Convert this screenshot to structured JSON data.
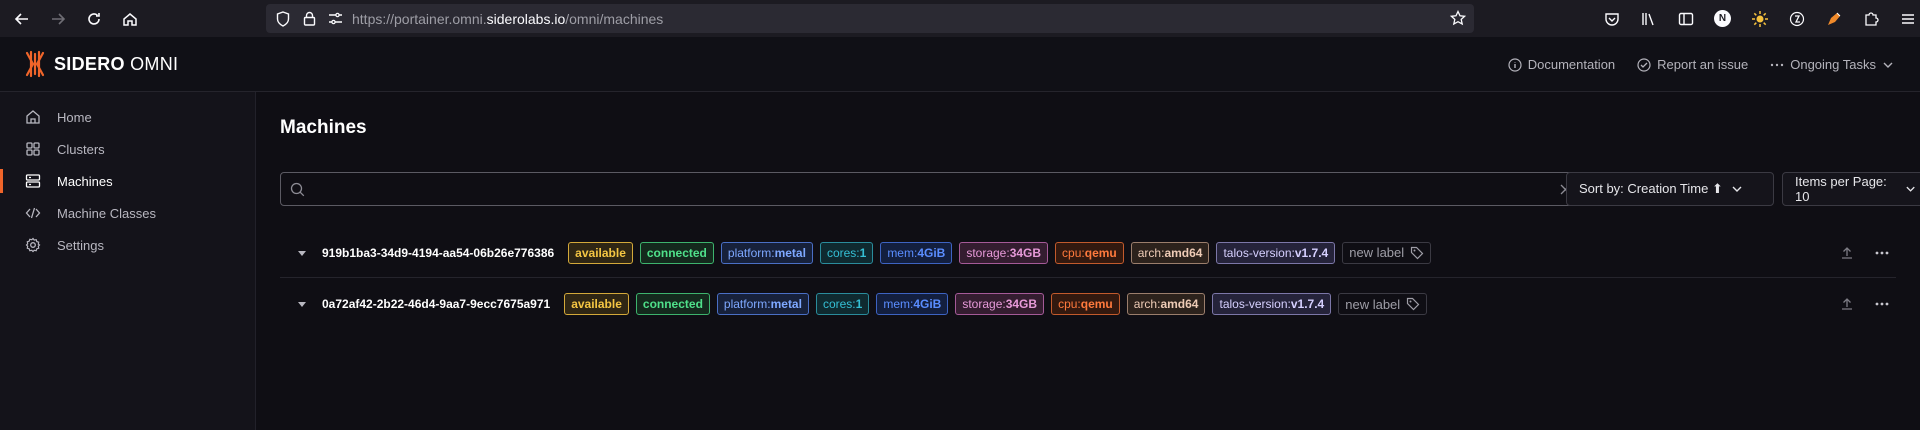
{
  "browser": {
    "url_prefix": "https://portainer.omni.",
    "url_domain": "siderolabs.io",
    "url_path": "/omni/machines",
    "profile_initial": "N"
  },
  "header": {
    "logo_bold": "SIDERO",
    "logo_light": " OMNI",
    "links": {
      "documentation": "Documentation",
      "report": "Report an issue",
      "tasks": "Ongoing Tasks"
    }
  },
  "sidebar": {
    "items": [
      {
        "label": "Home",
        "icon": "home-icon"
      },
      {
        "label": "Clusters",
        "icon": "grid-icon"
      },
      {
        "label": "Machines",
        "icon": "server-icon",
        "active": true
      },
      {
        "label": "Machine Classes",
        "icon": "code-icon"
      },
      {
        "label": "Settings",
        "icon": "gear-icon"
      }
    ]
  },
  "main": {
    "title": "Machines",
    "search": {
      "value": "",
      "placeholder": ""
    },
    "sort_label": "Sort by: Creation Time ⬆",
    "items_per_page": "Items per Page: 10"
  },
  "machines": [
    {
      "id": "919b1ba3-34d9-4194-aa54-06b26e776386",
      "labels": {
        "available": "available",
        "connected": "connected",
        "platform_key": "platform:",
        "platform_val": "metal",
        "cores_key": "cores:",
        "cores_val": "1",
        "mem_key": "mem:",
        "mem_val": "4GiB",
        "storage_key": "storage:",
        "storage_val": "34GB",
        "cpu_key": "cpu:",
        "cpu_val": "qemu",
        "arch_key": "arch:",
        "arch_val": "amd64",
        "talos_key": "talos-version:",
        "talos_val": "v1.7.4"
      },
      "new_label": "new label"
    },
    {
      "id": "0a72af42-2b22-46d4-9aa7-9ecc7675a971",
      "labels": {
        "available": "available",
        "connected": "connected",
        "platform_key": "platform:",
        "platform_val": "metal",
        "cores_key": "cores:",
        "cores_val": "1",
        "mem_key": "mem:",
        "mem_val": "4GiB",
        "storage_key": "storage:",
        "storage_val": "34GB",
        "cpu_key": "cpu:",
        "cpu_val": "qemu",
        "arch_key": "arch:",
        "arch_val": "amd64",
        "talos_key": "talos-version:",
        "talos_val": "v1.7.4"
      },
      "new_label": "new label"
    }
  ],
  "colors": {
    "accent": "#f0652a",
    "background": "#0f0e14",
    "sidebar": "#14131a"
  }
}
